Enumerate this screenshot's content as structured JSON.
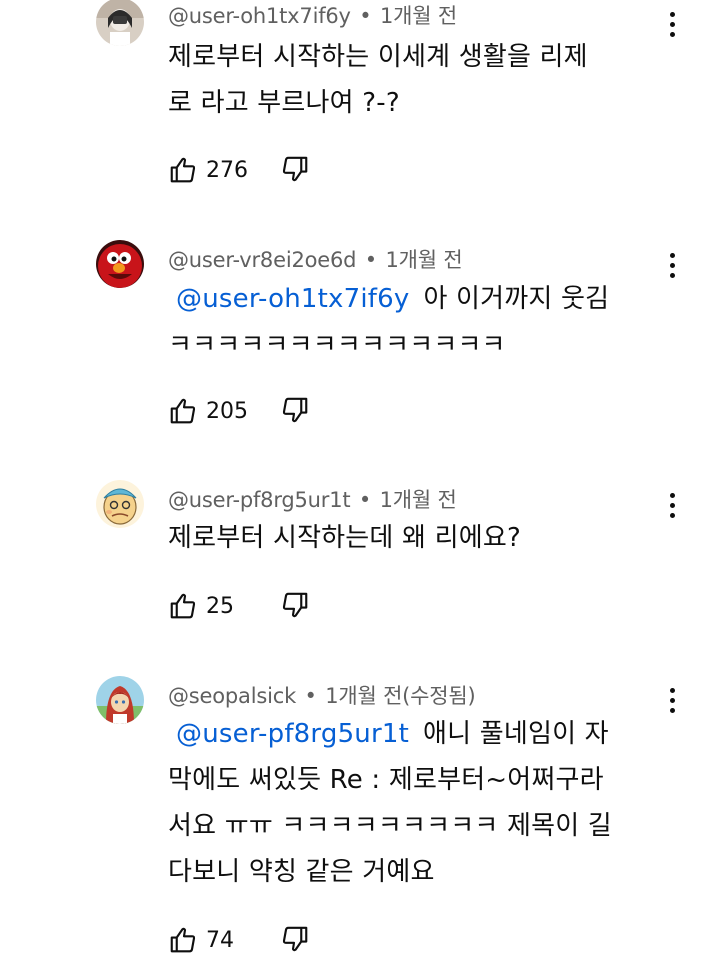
{
  "comments": [
    {
      "author": "@user-oh1tx7if6y",
      "time": "1개월 전",
      "lines": [
        "제로부터 시작하는 이세계 생활을 리제",
        "로 라고 부르나여 ?-?"
      ],
      "likes": "276",
      "avatar_colors": [
        "#d8cfc4",
        "#2b2b2b",
        "#f1ece6"
      ]
    },
    {
      "author": "@user-vr8ei2oe6d",
      "time": "1개월 전",
      "mention": "@user-oh1tx7if6y",
      "lines": [
        "아 이거까지 웃김",
        "ㅋㅋㅋㅋㅋㅋㅋㅋㅋㅋㅋㅋㅋㅋ"
      ],
      "likes": "205",
      "avatar_colors": [
        "#c8141a",
        "#ffffff",
        "#f39a1e"
      ]
    },
    {
      "author": "@user-pf8rg5ur1t",
      "time": "1개월 전",
      "lines": [
        "제로부터 시작하는데 왜 리에요?"
      ],
      "likes": "25",
      "avatar_colors": [
        "#f5d28c",
        "#5fb7d6",
        "#f2b27a"
      ]
    },
    {
      "author": "@seopalsick",
      "time": "1개월 전(수정됨)",
      "mention": "@user-pf8rg5ur1t",
      "lines": [
        "애니 풀네임이 자",
        "막에도 써있듯 Re : 제로부터~어쩌구라",
        "서요 ㅠㅠ ㅋㅋㅋㅋㅋㅋㅋㅋㅋ 제목이 길",
        "다보니 약칭 같은 거예요"
      ],
      "likes": "74",
      "avatar_colors": [
        "#9fd3e8",
        "#c0392b",
        "#f3d6b0"
      ]
    }
  ],
  "icons": {
    "like": "thumbs-up-icon",
    "dislike": "thumbs-down-icon",
    "menu": "more-vert-icon"
  },
  "colors": {
    "text": "#0f0f0f",
    "meta": "#606060",
    "mention": "#065fd4"
  }
}
